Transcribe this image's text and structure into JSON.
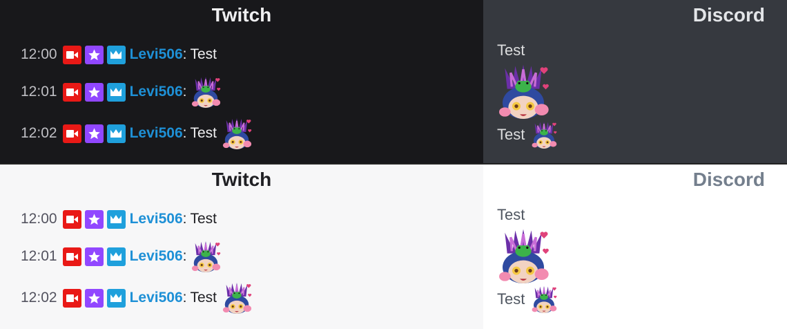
{
  "sections": [
    {
      "theme": "dark",
      "twitch_title": "Twitch",
      "discord_title": "Discord",
      "messages": [
        {
          "time": "12:00",
          "user": "Levi506",
          "colon": ":",
          "text": "Test",
          "emote": false
        },
        {
          "time": "12:01",
          "user": "Levi506",
          "colon": ":",
          "text": "",
          "emote": true
        },
        {
          "time": "12:02",
          "user": "Levi506",
          "colon": ":",
          "text": "Test",
          "emote": true
        }
      ],
      "discord_messages": [
        {
          "text": "Test"
        },
        {
          "text": "Test"
        }
      ]
    },
    {
      "theme": "light",
      "twitch_title": "Twitch",
      "discord_title": "Discord",
      "messages": [
        {
          "time": "12:00",
          "user": "Levi506",
          "colon": ":",
          "text": "Test",
          "emote": false
        },
        {
          "time": "12:01",
          "user": "Levi506",
          "colon": ":",
          "text": "",
          "emote": true
        },
        {
          "time": "12:02",
          "user": "Levi506",
          "colon": ":",
          "text": "Test",
          "emote": true
        }
      ],
      "discord_messages": [
        {
          "text": "Test"
        },
        {
          "text": "Test"
        }
      ]
    }
  ],
  "badges": [
    "video-camera-icon",
    "star-icon",
    "crown-icon"
  ],
  "colors": {
    "username": "#1e90d6",
    "badge_camera": "#e91916",
    "badge_star": "#9147ff",
    "badge_crown": "#1fa0dc"
  }
}
